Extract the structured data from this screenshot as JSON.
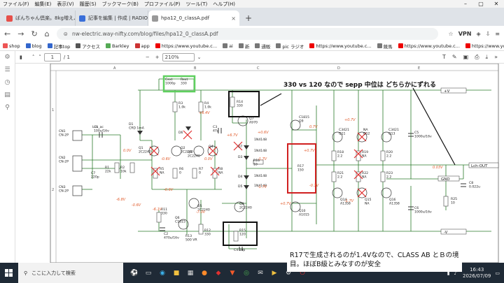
{
  "menu": {
    "items": [
      "ファイル(F)",
      "編集(E)",
      "表示(V)",
      "履歴(S)",
      "ブックマーク(B)",
      "プロファイル(P)",
      "ツール(T)",
      "ヘルプ(H)"
    ]
  },
  "tabs": [
    {
      "title": "ばんちゃん倶楽。8kg増えムッチリ'ぶ",
      "color": "#e6504a"
    },
    {
      "title": "記事を編集 | 作成 | RADIO KITS",
      "color": "#3a6fd9"
    },
    {
      "title": "hpa12_0_classA.pdf",
      "color": "#999"
    }
  ],
  "address": {
    "url": "nw-electric.way-nifty.com/blog/files/hpa12_0_classA.pdf",
    "vpn": "VPN"
  },
  "bookmarks": [
    {
      "label": "shop",
      "color": "#e55"
    },
    {
      "label": "blog",
      "color": "#36c"
    },
    {
      "label": "記事top",
      "color": "#36c"
    },
    {
      "label": "アクセス",
      "color": "#555"
    },
    {
      "label": "Barkley",
      "color": "#5a5"
    },
    {
      "label": "app",
      "color": "#c33"
    },
    {
      "label": "https://www.youtube.c...",
      "color": "#e00"
    },
    {
      "label": "ai",
      "color": "#777"
    },
    {
      "label": "新",
      "color": "#777"
    },
    {
      "label": "通販",
      "color": "#777"
    },
    {
      "label": "pic ラジオ",
      "color": "#777"
    },
    {
      "label": "https://www.youtube.c...",
      "color": "#e00"
    },
    {
      "label": "競馬",
      "color": "#777"
    },
    {
      "label": "https://www.youtube.c...",
      "color": "#e00"
    },
    {
      "label": "https://www.youtube.c...",
      "color": "#e00"
    }
  ],
  "pdf": {
    "page": "1",
    "total": "/ 1",
    "zoom": "210%"
  },
  "annotation": {
    "top_note": "330 vs 120 なので  sepp 中位は  どちらかにずれる",
    "caption": "R17で生成されるのが1.4Vなので、CLASS AB とＢの境目。ほぼB級とみなすのが安全"
  },
  "schematic": {
    "col_labels": [
      "A",
      "B",
      "C",
      "D",
      "E"
    ],
    "row_labels": [
      "1",
      "2"
    ],
    "rails": {
      "plus": "+V",
      "minus": "-V",
      "gnd": "GND",
      "out": "Lch-OUT"
    },
    "parts": [
      {
        "id": "cin",
        "text": "C1\n100u/16v"
      },
      {
        "id": "cn1",
        "text": "CN1\nCN-2P"
      },
      {
        "id": "cn2",
        "text": "CN2\nCN-2P"
      },
      {
        "id": "cn3",
        "text": "CN3\nCN-2P"
      },
      {
        "id": "lin",
        "text": "L-in_ac"
      },
      {
        "id": "c7",
        "text": "C7\n220p"
      },
      {
        "id": "r1",
        "text": "R1\n22k"
      },
      {
        "id": "r2",
        "text": "R2\n10k"
      },
      {
        "id": "d1",
        "text": "D1\nCRD 1mA"
      },
      {
        "id": "cext",
        "text": "Cext\n1000p"
      },
      {
        "id": "rext",
        "text": "Rext\n330"
      },
      {
        "id": "r3",
        "text": "R3\n1.0k"
      },
      {
        "id": "r4",
        "text": "R4\n1.0k"
      },
      {
        "id": "d6",
        "text": "D6"
      },
      {
        "id": "q1",
        "text": "Q1\n2C2240"
      },
      {
        "id": "q2",
        "text": "Q2\n2C2240"
      },
      {
        "id": "q3",
        "text": "Q3\n2C2240"
      },
      {
        "id": "q4",
        "text": "Q4"
      },
      {
        "id": "r5",
        "text": "R5\nNA"
      },
      {
        "id": "r6",
        "text": "R6\n0"
      },
      {
        "id": "r7",
        "text": "R7\n0"
      },
      {
        "id": "r8",
        "text": "R8\nNA"
      },
      {
        "id": "c3",
        "text": "C3\n47p"
      },
      {
        "id": "r14",
        "text": "R14\n330"
      },
      {
        "id": "q7",
        "text": "Q7\nA970"
      },
      {
        "id": "d7",
        "text": "D7"
      },
      {
        "id": "d3",
        "text": "D3"
      },
      {
        "id": "d4",
        "text": "D4"
      },
      {
        "id": "d5",
        "text": "D5"
      },
      {
        "id": "dt1",
        "text": "1N4148"
      },
      {
        "id": "dt2",
        "text": "1N4148"
      },
      {
        "id": "dt3",
        "text": "1N4148"
      },
      {
        "id": "dt4",
        "text": "1N4148"
      },
      {
        "id": "r16",
        "text": "R16\n10"
      },
      {
        "id": "r17",
        "text": "R17\n150"
      },
      {
        "id": "q9",
        "text": "C1815\nQ9"
      },
      {
        "id": "q10",
        "text": "Q10\nA1015"
      },
      {
        "id": "q8",
        "text": "Q8\n2C2240"
      },
      {
        "id": "q5",
        "text": "Q5\n2C2240"
      },
      {
        "id": "q6",
        "text": "Q6\nC1815"
      },
      {
        "id": "r11",
        "text": "R11\n330"
      },
      {
        "id": "r13",
        "text": "R13\n500 VR"
      },
      {
        "id": "r12",
        "text": "R12\n330"
      },
      {
        "id": "c2",
        "text": "C2\n470u/16v"
      },
      {
        "id": "r15",
        "text": "R15\n120"
      },
      {
        "id": "c4",
        "text": "C4  10p"
      },
      {
        "id": "q11",
        "text": "C3421\nQ11"
      },
      {
        "id": "q12",
        "text": "NA\nQ12"
      },
      {
        "id": "q13",
        "text": "C3421\nQ13"
      },
      {
        "id": "q14",
        "text": "Q14\nA1358"
      },
      {
        "id": "q15",
        "text": "Q15\nNA"
      },
      {
        "id": "q16",
        "text": "Q16\nA1358"
      },
      {
        "id": "r18",
        "text": "R18\n2.2"
      },
      {
        "id": "r19",
        "text": "R19\nNA"
      },
      {
        "id": "r20",
        "text": "R20\n2.2"
      },
      {
        "id": "r21",
        "text": "R21\n2.2"
      },
      {
        "id": "r22",
        "text": "R22\nNA"
      },
      {
        "id": "r23",
        "text": "R23\n2.2"
      },
      {
        "id": "c5",
        "text": "C5\n1000u/16v"
      },
      {
        "id": "c6",
        "text": "C6\n1000u/16v"
      },
      {
        "id": "c8",
        "text": "C8\n0.022u"
      },
      {
        "id": "r25",
        "text": "R25\n10"
      }
    ],
    "voltages": [
      "0.0V",
      "0.0V",
      "-0.6V",
      "-0.6V",
      "-0.6V",
      "-6.8V",
      "+6.4V",
      "+0.6V",
      "-1.7V",
      "+0.7V",
      "-1.7V",
      "+0.7V",
      "-6.1V",
      "-7.0V",
      "0.7V",
      "-0.7V",
      "+0.7V",
      "-1.7V",
      "+6.7V",
      "0.03V"
    ]
  },
  "taskbar": {
    "search": "ここに入力して検索",
    "time": "16:43",
    "date": "2026/07/09"
  }
}
